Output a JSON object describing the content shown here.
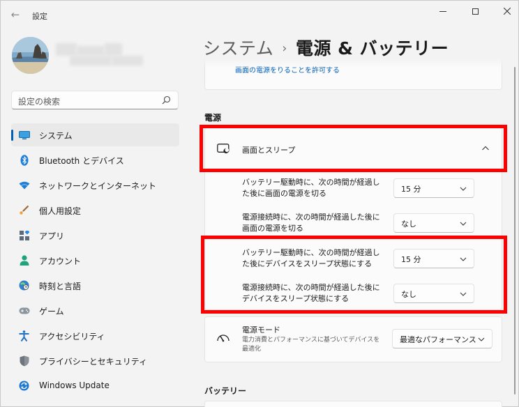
{
  "window": {
    "title": "設定",
    "back_icon": "back-arrow-icon"
  },
  "user": {
    "name": ""
  },
  "search": {
    "placeholder": "設定の検索"
  },
  "nav": [
    {
      "label": "システム",
      "icon": "system-display-icon",
      "active": true
    },
    {
      "label": "Bluetooth とデバイス",
      "icon": "bluetooth-icon"
    },
    {
      "label": "ネットワークとインターネット",
      "icon": "wifi-icon"
    },
    {
      "label": "個人用設定",
      "icon": "brush-icon"
    },
    {
      "label": "アプリ",
      "icon": "apps-icon"
    },
    {
      "label": "アカウント",
      "icon": "account-icon"
    },
    {
      "label": "時刻と言語",
      "icon": "time-language-icon"
    },
    {
      "label": "ゲーム",
      "icon": "gamepad-icon"
    },
    {
      "label": "アクセシビリティ",
      "icon": "accessibility-icon"
    },
    {
      "label": "プライバシーとセキュリティ",
      "icon": "shield-icon"
    },
    {
      "label": "Windows Update",
      "icon": "windows-update-icon"
    }
  ],
  "header": {
    "parent": "システム",
    "separator": "›",
    "current": "電源 & バッテリー"
  },
  "top_card": {
    "link_text": "画面の電源をりることを許可する"
  },
  "power_section": {
    "label": "電源",
    "sleep": {
      "label": "画面とスリープ",
      "rows": [
        {
          "text": "バッテリー駆動時に、次の時間が経過した後に画面の電源を切る",
          "value": "15 分"
        },
        {
          "text": "電源接続時に、次の時間が経過した後に画面の電源を切る",
          "value": "なし"
        },
        {
          "text": "バッテリー駆動時に、次の時間が経過した後にデバイスをスリープ状態にする",
          "value": "15 分"
        },
        {
          "text": "電源接続時に、次の時間が経過した後にデバイスをスリープ状態にする",
          "value": "なし"
        }
      ]
    },
    "mode": {
      "title": "電源モード",
      "description": "電力消費とパフォーマンスに基づいてデバイスを最適化",
      "value": "最適なパフォーマンス"
    }
  },
  "battery_section": {
    "label": "バッテリー"
  },
  "colors": {
    "accent": "#005fb8",
    "highlight": "#ff0000",
    "background": "#f3f3f3",
    "card": "#fbfbfb"
  }
}
